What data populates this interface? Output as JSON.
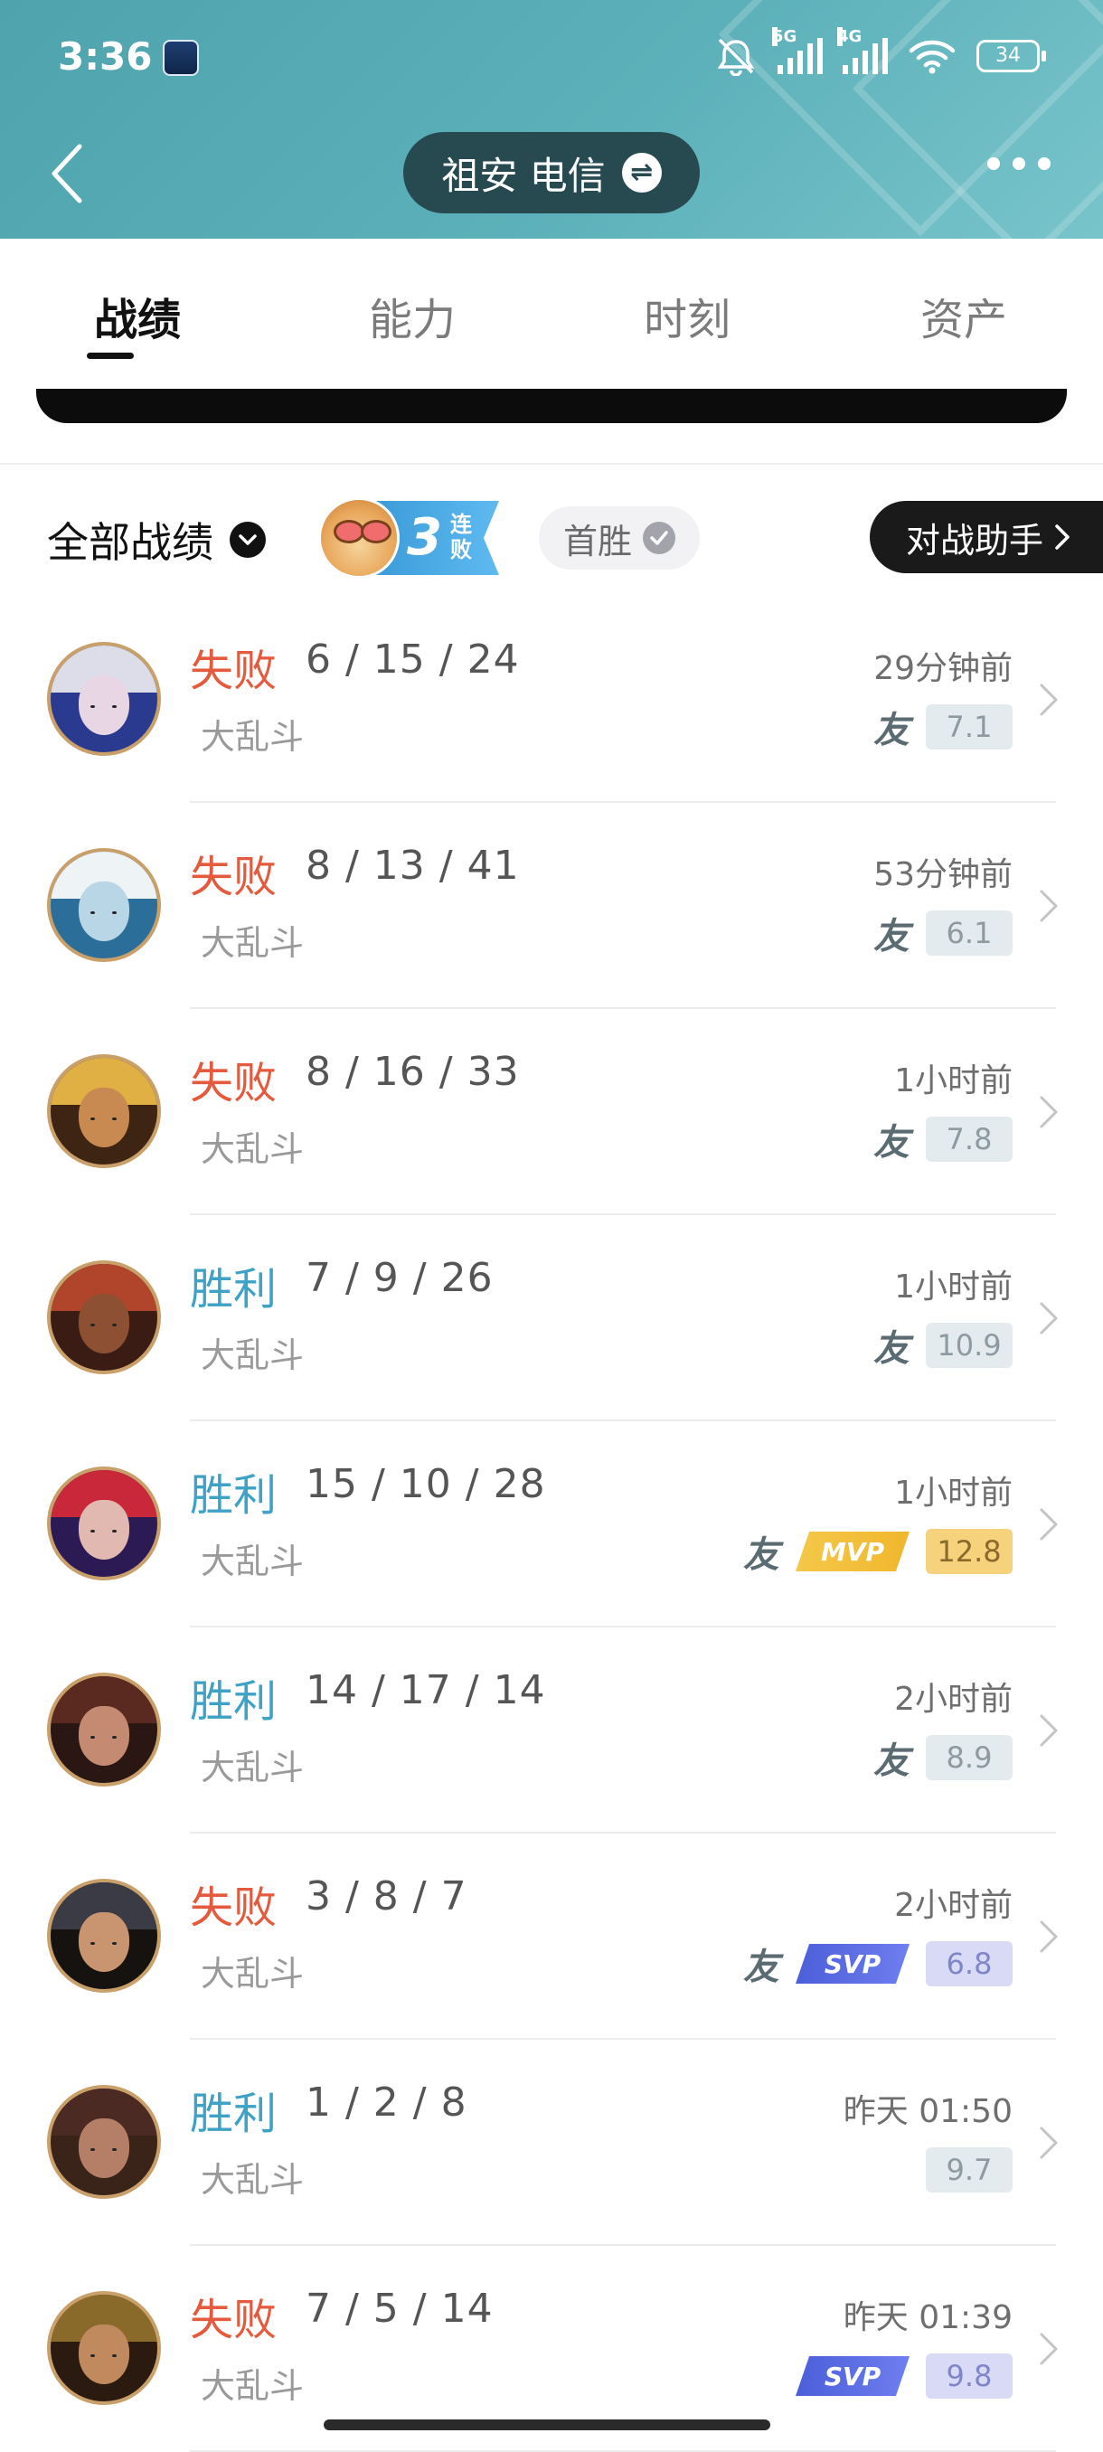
{
  "status_bar": {
    "time": "3:36",
    "net1": "5G",
    "net2": "4G",
    "battery": "34"
  },
  "header": {
    "region": "祖安 电信"
  },
  "tabs": [
    "战绩",
    "能力",
    "时刻",
    "资产"
  ],
  "filter": {
    "label": "全部战绩",
    "streak_num": "3",
    "streak_text": "连败",
    "first_win": "首胜",
    "assistant": "对战助手"
  },
  "friend_tag": "友",
  "mvp_label": "MVP",
  "svp_label": "SVP",
  "matches": [
    {
      "result": "失败",
      "outcome": "lose",
      "kda": "6 / 15 / 24",
      "mode": "大乱斗",
      "time": "29分钟前",
      "friend": true,
      "badge": "",
      "score": "7.1",
      "avatar_colors": [
        "#2a3b8f",
        "#e8d6e4",
        "#dcdde8"
      ]
    },
    {
      "result": "失败",
      "outcome": "lose",
      "kda": "8 / 13 / 41",
      "mode": "大乱斗",
      "time": "53分钟前",
      "friend": true,
      "badge": "",
      "score": "6.1",
      "avatar_colors": [
        "#2b6e9a",
        "#b9d6e6",
        "#eef3f6"
      ]
    },
    {
      "result": "失败",
      "outcome": "lose",
      "kda": "8 / 16 / 33",
      "mode": "大乱斗",
      "time": "1小时前",
      "friend": true,
      "badge": "",
      "score": "7.8",
      "avatar_colors": [
        "#3d2413",
        "#c98a52",
        "#e0b044"
      ]
    },
    {
      "result": "胜利",
      "outcome": "win",
      "kda": "7 / 9 / 26",
      "mode": "大乱斗",
      "time": "1小时前",
      "friend": true,
      "badge": "",
      "score": "10.9",
      "avatar_colors": [
        "#3a1c14",
        "#8e5032",
        "#b0452c"
      ]
    },
    {
      "result": "胜利",
      "outcome": "win",
      "kda": "15 / 10 / 28",
      "mode": "大乱斗",
      "time": "1小时前",
      "friend": true,
      "badge": "mvp",
      "score": "12.8",
      "avatar_colors": [
        "#2c1a55",
        "#e2b9b1",
        "#c8283a"
      ]
    },
    {
      "result": "胜利",
      "outcome": "win",
      "kda": "14 / 17 / 14",
      "mode": "大乱斗",
      "time": "2小时前",
      "friend": true,
      "badge": "",
      "score": "8.9",
      "avatar_colors": [
        "#2a1713",
        "#c58a72",
        "#5a2a20"
      ]
    },
    {
      "result": "失败",
      "outcome": "lose",
      "kda": "3 / 8 / 7",
      "mode": "大乱斗",
      "time": "2小时前",
      "friend": true,
      "badge": "svp",
      "score": "6.8",
      "avatar_colors": [
        "#15120f",
        "#c99570",
        "#3b3b46"
      ]
    },
    {
      "result": "胜利",
      "outcome": "win",
      "kda": "1 / 2 / 8",
      "mode": "大乱斗",
      "time": "昨天 01:50",
      "friend": false,
      "badge": "",
      "score": "9.7",
      "avatar_colors": [
        "#3a2419",
        "#b57e66",
        "#4a2a22"
      ]
    },
    {
      "result": "失败",
      "outcome": "lose",
      "kda": "7 / 5 / 14",
      "mode": "大乱斗",
      "time": "昨天 01:39",
      "friend": false,
      "badge": "svp",
      "score": "9.8",
      "avatar_colors": [
        "#2b1a10",
        "#c08a5e",
        "#8a6a2b"
      ]
    }
  ]
}
